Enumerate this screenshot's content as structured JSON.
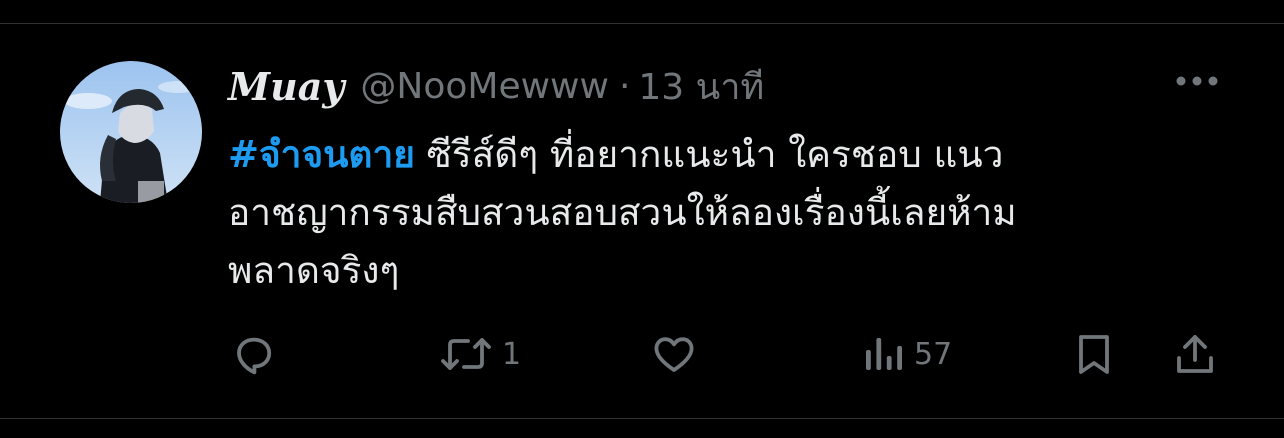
{
  "tweet": {
    "display_name": "Muay",
    "handle": "@NooMewww",
    "separator": "·",
    "time": "13 นาที",
    "hashtag": "#จำจนตาย",
    "text_line1_rest": " ซีรีส์ดีๆ ที่อยากแนะนำ ใครชอบ แนว",
    "text_line2": "อาชญากรรมสืบสวนสอบสวนให้ลองเรื่องนี้เลยห้าม",
    "text_line3": "พลาดจริงๆ"
  },
  "actions": {
    "reply_count": "",
    "retweet_count": "1",
    "like_count": "",
    "views_count": "57"
  },
  "icons": {
    "more": "more-horizontal-icon",
    "reply": "reply-icon",
    "retweet": "retweet-icon",
    "like": "heart-icon",
    "views": "views-icon",
    "bookmark": "bookmark-icon",
    "share": "share-icon"
  },
  "colors": {
    "background": "#000000",
    "text": "#e7e9ea",
    "secondary": "#71767b",
    "accent": "#1d9bf0",
    "divider": "#2f3336"
  }
}
